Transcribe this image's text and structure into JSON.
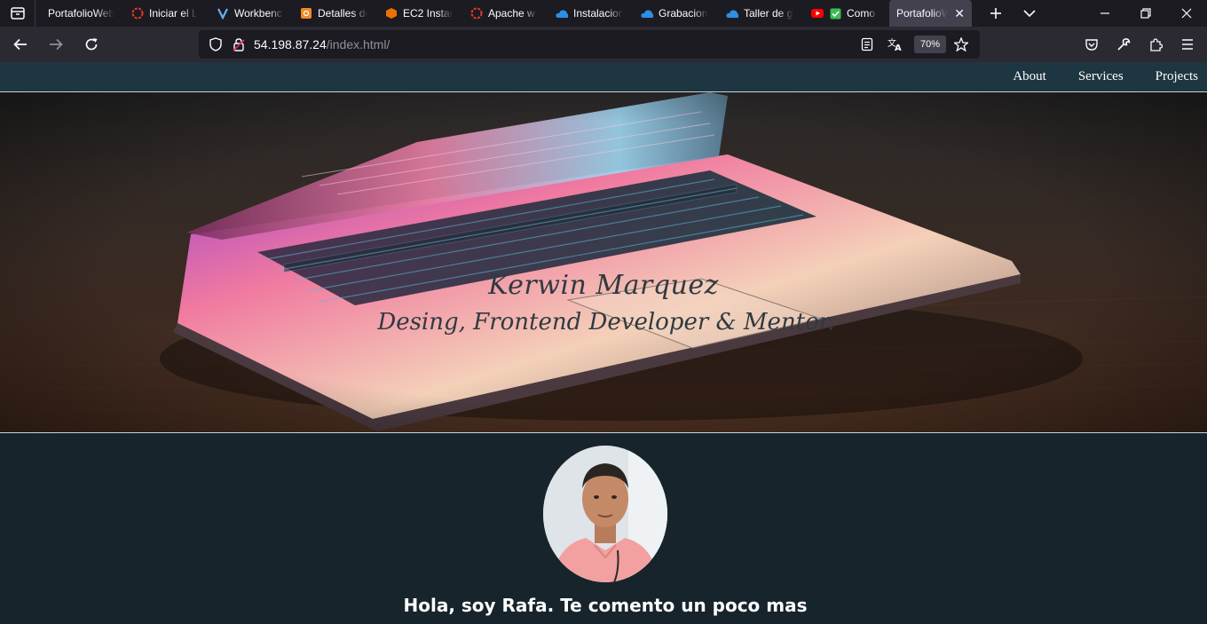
{
  "browser": {
    "tabs": [
      {
        "title": "PortafolioWeb",
        "icon": "none"
      },
      {
        "title": "Iniciar el L",
        "icon": "red-ring-icon"
      },
      {
        "title": "Workbenc",
        "icon": "vuln-v-icon"
      },
      {
        "title": "Detalles de",
        "icon": "orange-box-icon"
      },
      {
        "title": "EC2 Instan",
        "icon": "aws-cube-icon"
      },
      {
        "title": "Apache w",
        "icon": "red-ring-icon"
      },
      {
        "title": "Instalacion",
        "icon": "onedrive-cloud-icon"
      },
      {
        "title": "Grabacion",
        "icon": "onedrive-cloud-icon"
      },
      {
        "title": "Taller de g",
        "icon": "onedrive-cloud-icon"
      },
      {
        "title": "Como",
        "icon": "youtube-icon"
      },
      {
        "title": "PortafolioW",
        "icon": "none",
        "active": true
      }
    ],
    "url_host": "54.198.87.24",
    "url_path": "/index.html/",
    "zoom": "70%"
  },
  "site": {
    "nav": [
      "About",
      "Services",
      "Projects"
    ],
    "hero_name": "Kerwin Marquez",
    "hero_subtitle": "Desing, Frontend Developer & Mentor.",
    "greeting": "Hola, soy Rafa. Te comento un poco mas"
  },
  "colors": {
    "site_nav_bg": "#1d3641",
    "page_bg": "#17242b",
    "browser_chrome": "#2b2a33"
  }
}
